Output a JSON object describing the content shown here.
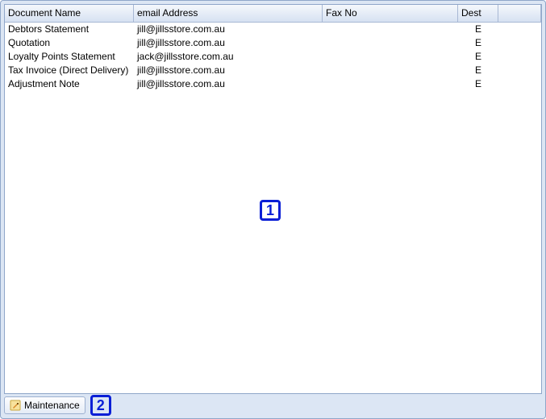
{
  "table": {
    "columns": {
      "document": "Document Name",
      "email": "email Address",
      "fax": "Fax No",
      "dest": "Dest"
    },
    "rows": [
      {
        "document": "Debtors Statement",
        "email": "jill@jillsstore.com.au",
        "fax": "",
        "dest": "E"
      },
      {
        "document": "Quotation",
        "email": "jill@jillsstore.com.au",
        "fax": "",
        "dest": "E"
      },
      {
        "document": "Loyalty Points Statement",
        "email": "jack@jillsstore.com.au",
        "fax": "",
        "dest": "E"
      },
      {
        "document": "Tax Invoice (Direct Delivery)",
        "email": "jill@jillsstore.com.au",
        "fax": "",
        "dest": "E"
      },
      {
        "document": "Adjustment Note",
        "email": "jill@jillsstore.com.au",
        "fax": "",
        "dest": "E"
      }
    ]
  },
  "buttons": {
    "maintenance": "Maintenance"
  },
  "markers": {
    "one": "1",
    "two": "2"
  }
}
